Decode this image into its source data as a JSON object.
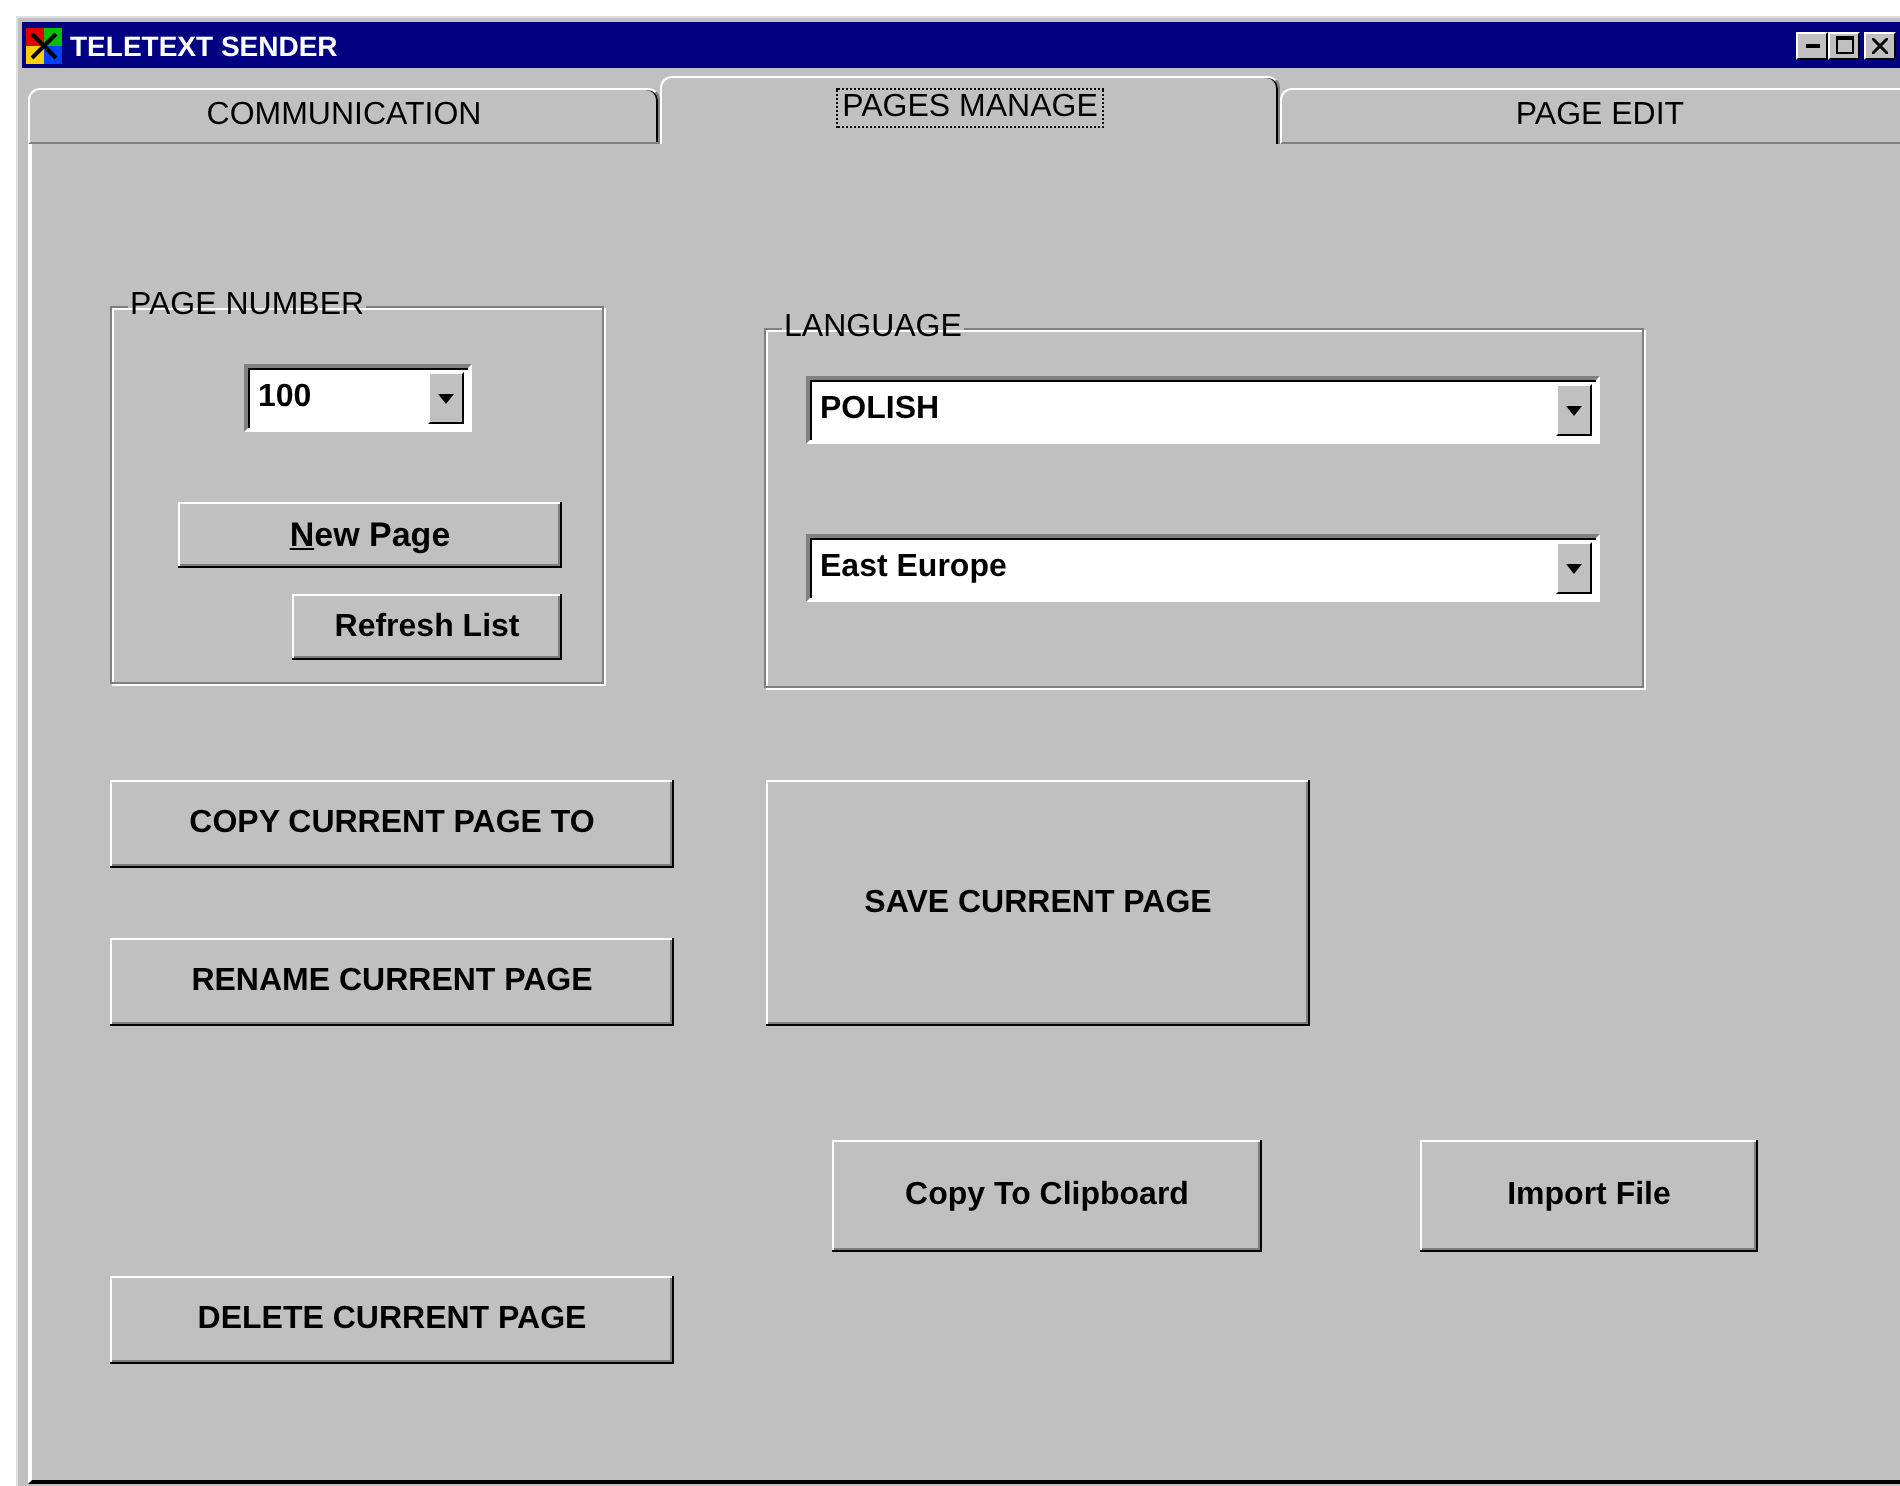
{
  "window": {
    "title": "TELETEXT SENDER"
  },
  "tabs": [
    {
      "label": "COMMUNICATION",
      "selected": false
    },
    {
      "label": "PAGES MANAGE",
      "selected": true
    },
    {
      "label": "PAGE EDIT",
      "selected": false
    }
  ],
  "page_number": {
    "label": "PAGE NUMBER",
    "value": "100",
    "new_page": {
      "mnemonic": "N",
      "rest": "ew Page"
    },
    "refresh": "Refresh List"
  },
  "language": {
    "label": "LANGUAGE",
    "language": "POLISH",
    "region": "East Europe"
  },
  "buttons": {
    "copy_to": "COPY CURRENT PAGE TO",
    "rename": "RENAME CURRENT PAGE",
    "save": "SAVE CURRENT PAGE",
    "clipboard": "Copy To Clipboard",
    "import": "Import File",
    "delete": "DELETE CURRENT PAGE"
  }
}
